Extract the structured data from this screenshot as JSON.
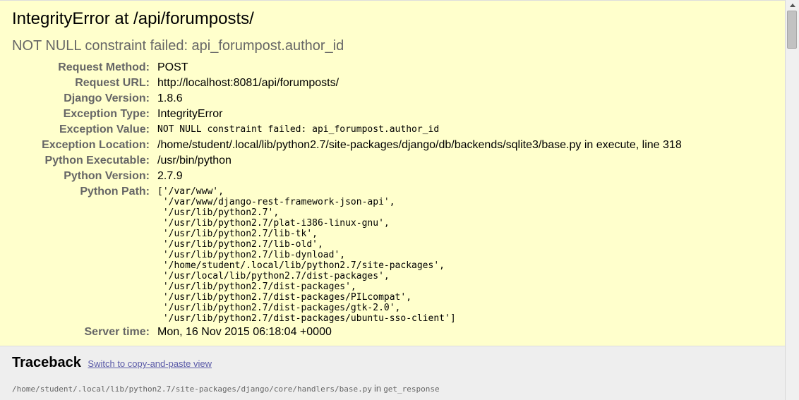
{
  "header": {
    "title": "IntegrityError at /api/forumposts/",
    "subtitle": "NOT NULL constraint failed: api_forumpost.author_id"
  },
  "meta": [
    {
      "key": "Request Method:",
      "value": "POST"
    },
    {
      "key": "Request URL:",
      "value": "http://localhost:8081/api/forumposts/"
    },
    {
      "key": "Django Version:",
      "value": "1.8.6"
    },
    {
      "key": "Exception Type:",
      "value": "IntegrityError"
    },
    {
      "key": "Exception Value:",
      "value": "NOT NULL constraint failed: api_forumpost.author_id"
    },
    {
      "key": "Exception Location:",
      "value": "/home/student/.local/lib/python2.7/site-packages/django/db/backends/sqlite3/base.py in execute, line 318"
    },
    {
      "key": "Python Executable:",
      "value": "/usr/bin/python"
    },
    {
      "key": "Python Version:",
      "value": "2.7.9"
    },
    {
      "key": "Python Path:",
      "value": ""
    },
    {
      "key": "Server time:",
      "value": "Mon, 16 Nov 2015 06:18:04 +0000"
    }
  ],
  "python_path": [
    "['/var/www',",
    " '/var/www/django-rest-framework-json-api',",
    " '/usr/lib/python2.7',",
    " '/usr/lib/python2.7/plat-i386-linux-gnu',",
    " '/usr/lib/python2.7/lib-tk',",
    " '/usr/lib/python2.7/lib-old',",
    " '/usr/lib/python2.7/lib-dynload',",
    " '/home/student/.local/lib/python2.7/site-packages',",
    " '/usr/local/lib/python2.7/dist-packages',",
    " '/usr/lib/python2.7/dist-packages',",
    " '/usr/lib/python2.7/dist-packages/PILcompat',",
    " '/usr/lib/python2.7/dist-packages/gtk-2.0',",
    " '/usr/lib/python2.7/dist-packages/ubuntu-sso-client']"
  ],
  "traceback": {
    "heading": "Traceback",
    "switch_link": "Switch to copy-and-paste view",
    "frame_file": "/home/student/.local/lib/python2.7/site-packages/django/core/handlers/base.py",
    "frame_in": "in",
    "frame_func": "get_response"
  },
  "colors": {
    "summary_bg": "#ffffcc",
    "page_bg": "#eeeeee",
    "key_text": "#666666",
    "link": "#5b5ba8"
  },
  "icons": {
    "scroll_up": "triangle-up-icon"
  }
}
